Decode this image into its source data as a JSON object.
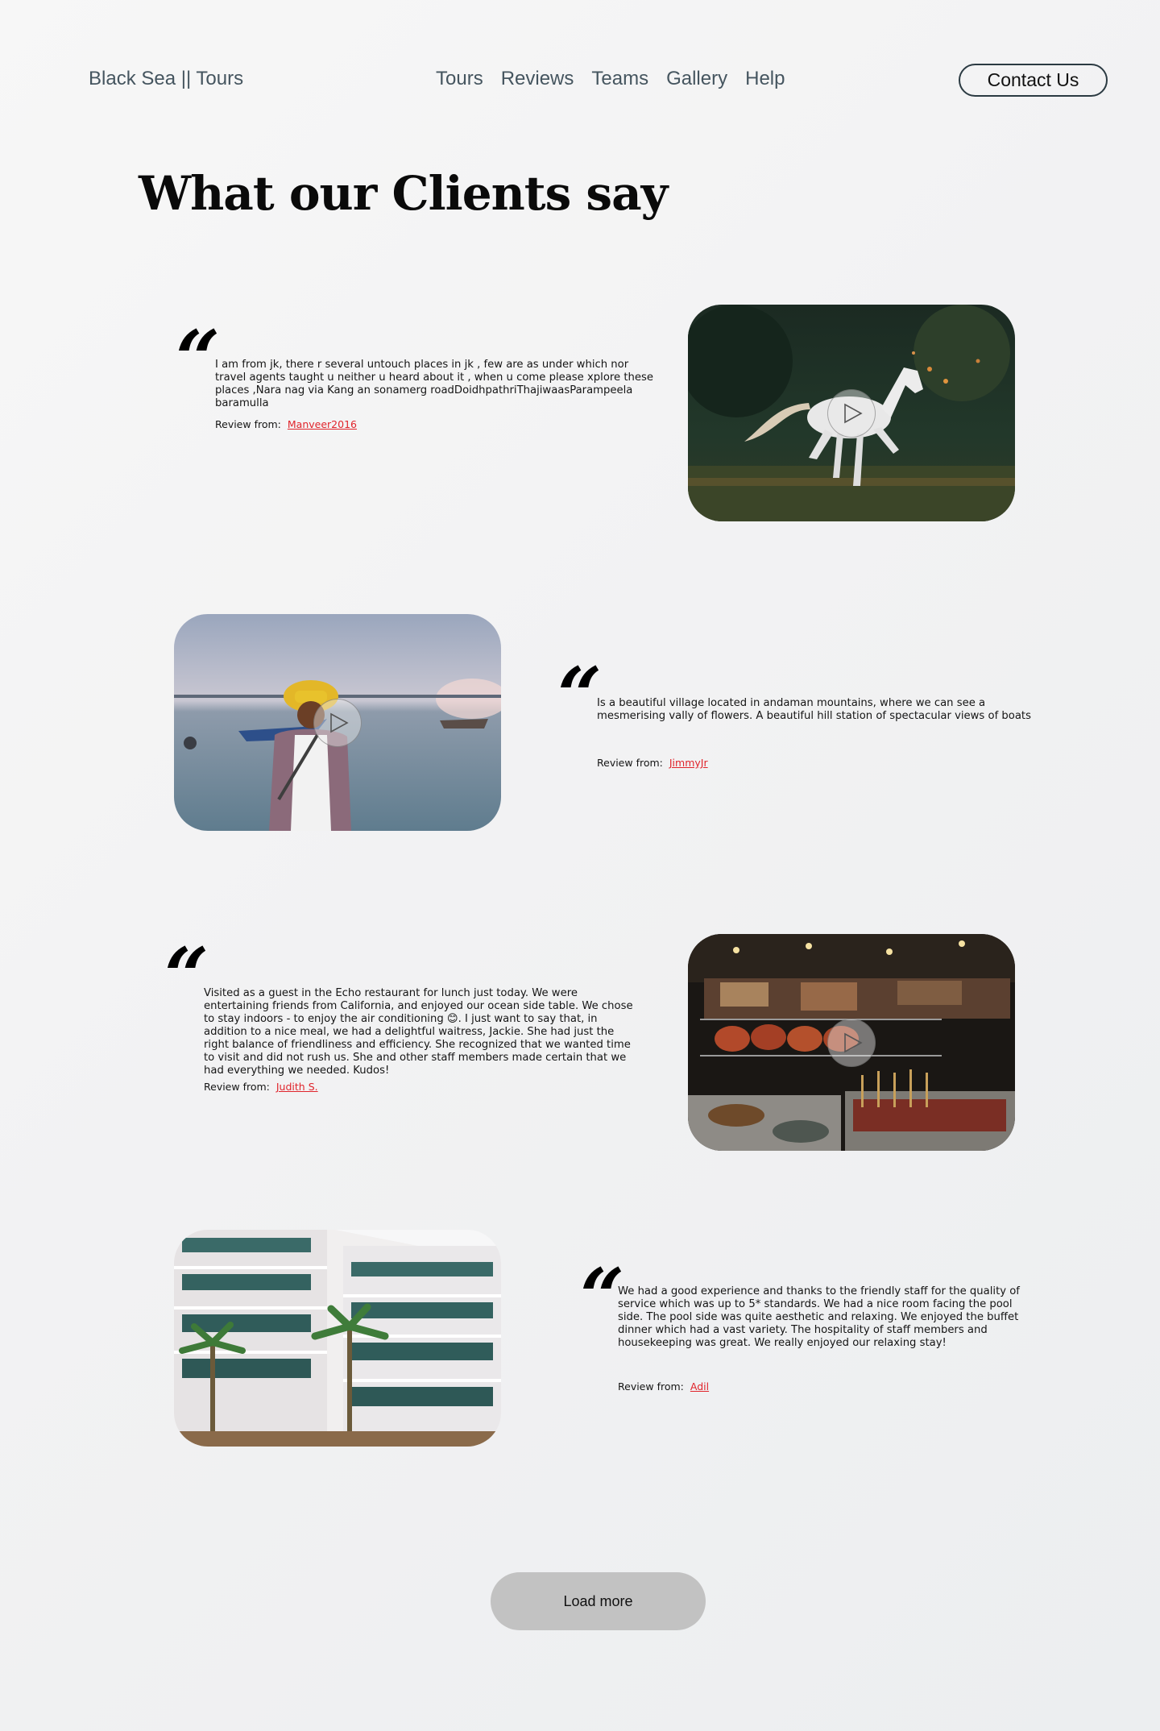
{
  "header": {
    "logo": "Black Sea || Tours",
    "nav": [
      "Tours",
      "Reviews",
      "Teams",
      "Gallery",
      "Help"
    ],
    "contact_label": "Contact Us"
  },
  "page_title": "What our Clients say",
  "review_from_label": "Review from:",
  "quote_glyph": "“",
  "reviews": [
    {
      "text": "I am from jk, there r several untouch places in jk , few are as under which nor travel agents taught u neither u heard about it , when u come please xplore these places ,Nara nag via Kang an sonamerg roadDoidhpathriThajiwaasParampeela baramulla",
      "author": "Manveer2016",
      "image": "horse-icon"
    },
    {
      "text": "Is a beautiful village located in andaman mountains, where we can see a mesmerising vally of flowers. A beautiful hill station of spectacular views of boats",
      "author": "JimmyJr",
      "image": "lake-fisherman-icon"
    },
    {
      "text": "Visited as a guest in the Echo restaurant for lunch just today. We were entertaining friends from California, and enjoyed our ocean side table. We chose to stay indoors - to enjoy the air conditioning 😊. I just want to say that, in addition to a nice meal, we had a delightful waitress, Jackie. She had just the right balance of friendliness and efficiency. She recognized that we wanted time to visit and did not rush us. She and other staff members made certain that we had everything we needed. Kudos!",
      "author": "Judith S.",
      "image": "night-market-icon"
    },
    {
      "text": "We had a good experience and thanks to the friendly staff for the quality of service which was up to 5* standards. We had a nice room facing the pool side. The pool side was quite aesthetic and relaxing. We enjoyed the buffet dinner which had a vast variety. The hospitality of staff members and housekeeping was great. We really enjoyed our relaxing stay!",
      "author": "Adil",
      "image": "hotel-icon"
    }
  ],
  "load_more_label": "Load more"
}
